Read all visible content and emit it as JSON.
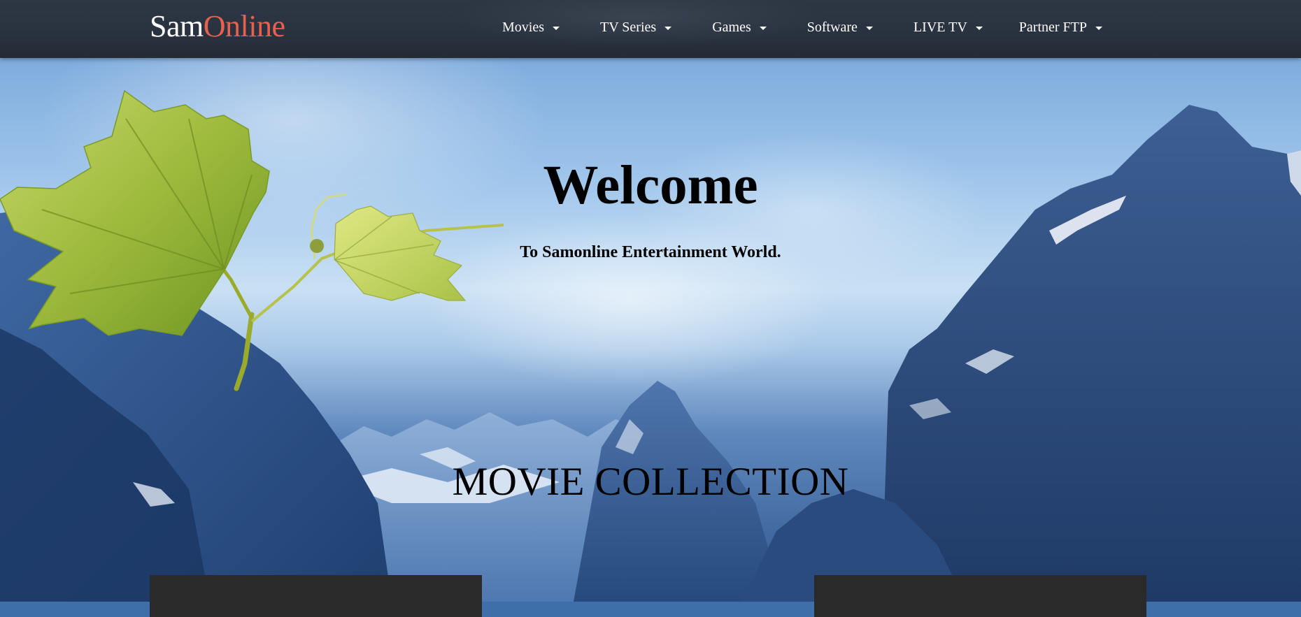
{
  "brand": {
    "part1": "Sam",
    "part2": "Online"
  },
  "nav": {
    "items": [
      {
        "label": "Movies"
      },
      {
        "label": "TV Series"
      },
      {
        "label": "Games"
      },
      {
        "label": "Software"
      },
      {
        "label": "LIVE TV"
      },
      {
        "label": "Partner FTP"
      }
    ]
  },
  "hero": {
    "title": "Welcome",
    "subtitle": "To Samonline Entertainment World."
  },
  "section": {
    "title": "MOVIE COLLECTION"
  },
  "colors": {
    "navbar": "#2a3340",
    "brand_accent": "#e8614f",
    "card": "#2a2a2a"
  }
}
